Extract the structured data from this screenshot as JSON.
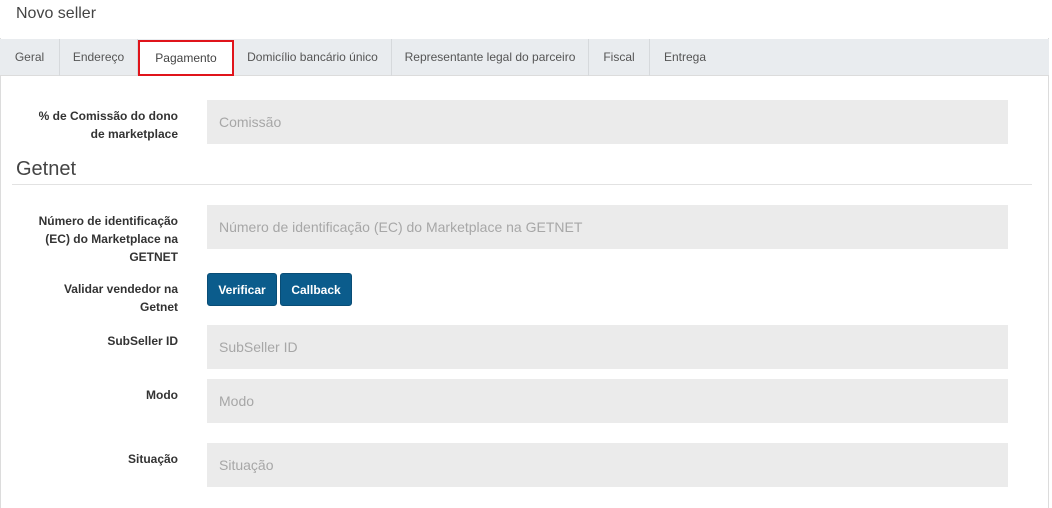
{
  "page": {
    "title": "Novo seller"
  },
  "tabs": [
    {
      "label": "Geral"
    },
    {
      "label": "Endereço"
    },
    {
      "label": "Pagamento"
    },
    {
      "label": "Domicílio bancário único"
    },
    {
      "label": "Representante legal do parceiro"
    },
    {
      "label": "Fiscal"
    },
    {
      "label": "Entrega"
    }
  ],
  "active_tab": "Pagamento",
  "form": {
    "commission": {
      "label_line1": "% de Comissão do dono",
      "label_line2": "de marketplace",
      "placeholder": "Comissão"
    },
    "section_title": "Getnet",
    "ec_number": {
      "label_line1": "Número de identificação",
      "label_line2": "(EC) do Marketplace na",
      "label_line3": "GETNET",
      "placeholder": "Número de identificação (EC) do Marketplace na GETNET"
    },
    "validate": {
      "label_line1": "Validar vendedor na",
      "label_line2": "Getnet",
      "verify_label": "Verificar",
      "callback_label": "Callback"
    },
    "subseller": {
      "label": "SubSeller ID",
      "placeholder": "SubSeller ID"
    },
    "mode": {
      "label": "Modo",
      "placeholder": "Modo"
    },
    "status": {
      "label": "Situação",
      "placeholder": "Situação"
    }
  },
  "colors": {
    "accent": "#0b5c8c",
    "active_tab_border": "#e0141b",
    "field_bg": "#ebebeb"
  }
}
